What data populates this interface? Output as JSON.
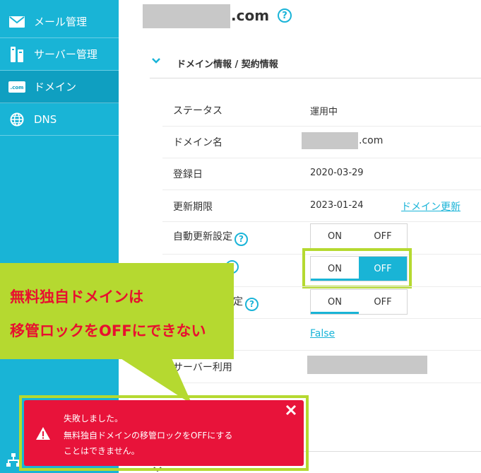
{
  "sidebar": {
    "items": [
      {
        "label": "メール管理",
        "icon": "mail-icon"
      },
      {
        "label": "サーバー管理",
        "icon": "server-icon"
      },
      {
        "label": "ドメイン",
        "icon": "domain-icon",
        "active": true
      },
      {
        "label": "DNS",
        "icon": "globe-icon"
      }
    ]
  },
  "header": {
    "domain_suffix": ".com",
    "help": "?"
  },
  "section": {
    "title": "ドメイン情報 / 契約情報"
  },
  "rows": {
    "status": {
      "label": "ステータス",
      "value": "運用中"
    },
    "domain_name": {
      "label": "ドメイン名",
      "value_suffix": ".com"
    },
    "registered": {
      "label": "登録日",
      "value": "2020-03-29"
    },
    "expires": {
      "label": "更新期限",
      "value": "2023-01-24",
      "link": "ドメイン更新"
    },
    "auto_renew": {
      "label": "自動更新設定"
    },
    "transfer_lock_tail": {
      "label": "定"
    },
    "hidden_value": {
      "link": "False"
    },
    "server_use": {
      "label": "サーバー利用"
    }
  },
  "toggles": {
    "on": "ON",
    "off": "OFF"
  },
  "annotation": {
    "line1": "無料独自ドメインは",
    "line2": "移管ロックをOFFにできない"
  },
  "toast": {
    "title": "失敗しました。",
    "line1": "無料独自ドメインの移管ロックをOFFにする",
    "line2": "ことはできません。"
  },
  "colors": {
    "accent": "#19b4d6",
    "highlight": "#b5d930",
    "error": "#e8133a",
    "annotation_text": "#e8102f"
  }
}
